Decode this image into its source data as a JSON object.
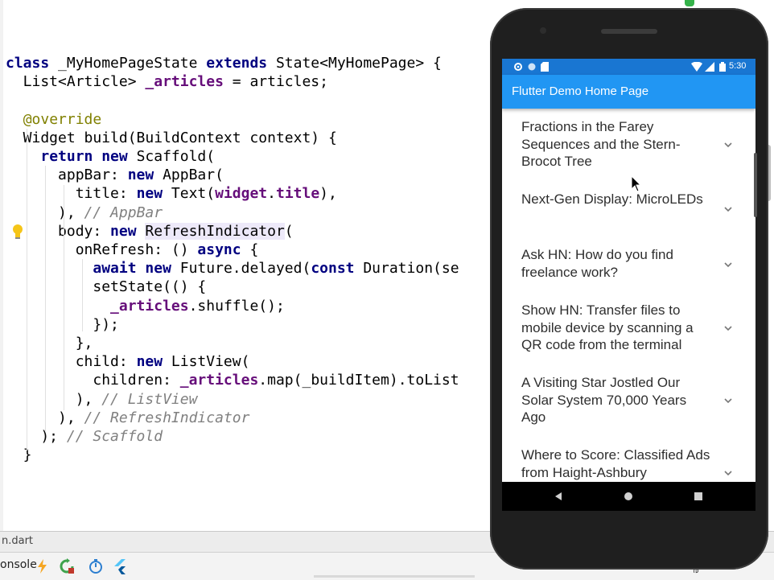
{
  "editor": {
    "lines": [
      [
        [
          "class",
          "kw"
        ],
        [
          " _MyHomePageState ",
          ""
        ],
        [
          "extends",
          "kw"
        ],
        [
          " State<MyHomePage> {",
          ""
        ]
      ],
      [
        [
          "  List<Article> ",
          ""
        ],
        [
          "_articles",
          "fld"
        ],
        [
          " = articles;",
          ""
        ]
      ],
      [
        [
          "",
          ""
        ]
      ],
      [
        [
          "  ",
          ""
        ],
        [
          "@override",
          "ann"
        ]
      ],
      [
        [
          "  Widget build(BuildContext context) {",
          ""
        ]
      ],
      [
        [
          "    ",
          ""
        ],
        [
          "return new",
          "kw"
        ],
        [
          " Scaffold(",
          ""
        ]
      ],
      [
        [
          "      appBar: ",
          ""
        ],
        [
          "new",
          "kw"
        ],
        [
          " AppBar(",
          ""
        ]
      ],
      [
        [
          "        title: ",
          ""
        ],
        [
          "new",
          "kw"
        ],
        [
          " Text(",
          ""
        ],
        [
          "widget",
          "fld"
        ],
        [
          ".",
          ""
        ],
        [
          "title",
          "fld"
        ],
        [
          "),",
          ""
        ]
      ],
      [
        [
          "      ), ",
          ""
        ],
        [
          "// AppBar",
          "cmt"
        ]
      ],
      [
        [
          "      body: ",
          ""
        ],
        [
          "new",
          "kw"
        ],
        [
          " ",
          ""
        ],
        [
          "RefreshIndicator",
          "hl"
        ],
        [
          "(",
          ""
        ]
      ],
      [
        [
          "        onRefresh: () ",
          ""
        ],
        [
          "async",
          "kw"
        ],
        [
          " {",
          ""
        ]
      ],
      [
        [
          "          ",
          ""
        ],
        [
          "await new",
          "kw"
        ],
        [
          " Future.delayed(",
          ""
        ],
        [
          "const",
          "kw"
        ],
        [
          " Duration(se",
          ""
        ]
      ],
      [
        [
          "          setState(() {",
          ""
        ]
      ],
      [
        [
          "            ",
          ""
        ],
        [
          "_articles",
          "fld"
        ],
        [
          ".shuffle();",
          ""
        ]
      ],
      [
        [
          "          });",
          ""
        ]
      ],
      [
        [
          "        },",
          ""
        ]
      ],
      [
        [
          "        child: ",
          ""
        ],
        [
          "new",
          "kw"
        ],
        [
          " ListView(",
          ""
        ]
      ],
      [
        [
          "          children: ",
          ""
        ],
        [
          "_articles",
          "fld"
        ],
        [
          ".map(_buildItem).toList",
          ""
        ]
      ],
      [
        [
          "        ), ",
          ""
        ],
        [
          "// ListView",
          "cmt"
        ]
      ],
      [
        [
          "      ), ",
          ""
        ],
        [
          "// RefreshIndicator",
          "cmt"
        ]
      ],
      [
        [
          "    ); ",
          ""
        ],
        [
          "// Scaffold",
          "cmt"
        ]
      ],
      [
        [
          "  }",
          ""
        ]
      ]
    ],
    "filetab": "n.dart",
    "console_tab": "onsole",
    "right_edge_text": "ce"
  },
  "phone": {
    "status_time": "5:30",
    "app_title": "Flutter Demo Home Page",
    "articles": [
      "Fractions in the Farey Sequences and the Stern-Brocot Tree",
      "Next-Gen Display: MicroLEDs",
      "Ask HN: How do you find freelance work?",
      "Show HN: Transfer files to mobile device by scanning a QR code from the terminal",
      "A Visiting Star Jostled Our Solar System 70,000 Years Ago",
      "Where to Score: Classified Ads from Haight-Ashbury"
    ]
  },
  "colors": {
    "keyword": "#000080",
    "field": "#660e7a",
    "comment": "#808080",
    "annotation": "#808000",
    "app_bar": "#2196f3",
    "status_bar": "#1976d2"
  },
  "icons": [
    "lightbulb-icon",
    "flutter-hot-reload-icon",
    "hot-restart-icon",
    "stopwatch-icon",
    "flutter-inspector-icon",
    "settings-icon",
    "wifi-icon",
    "battery-icon",
    "chevron-down-icon",
    "nav-back-icon",
    "nav-home-icon",
    "nav-recents-icon"
  ]
}
